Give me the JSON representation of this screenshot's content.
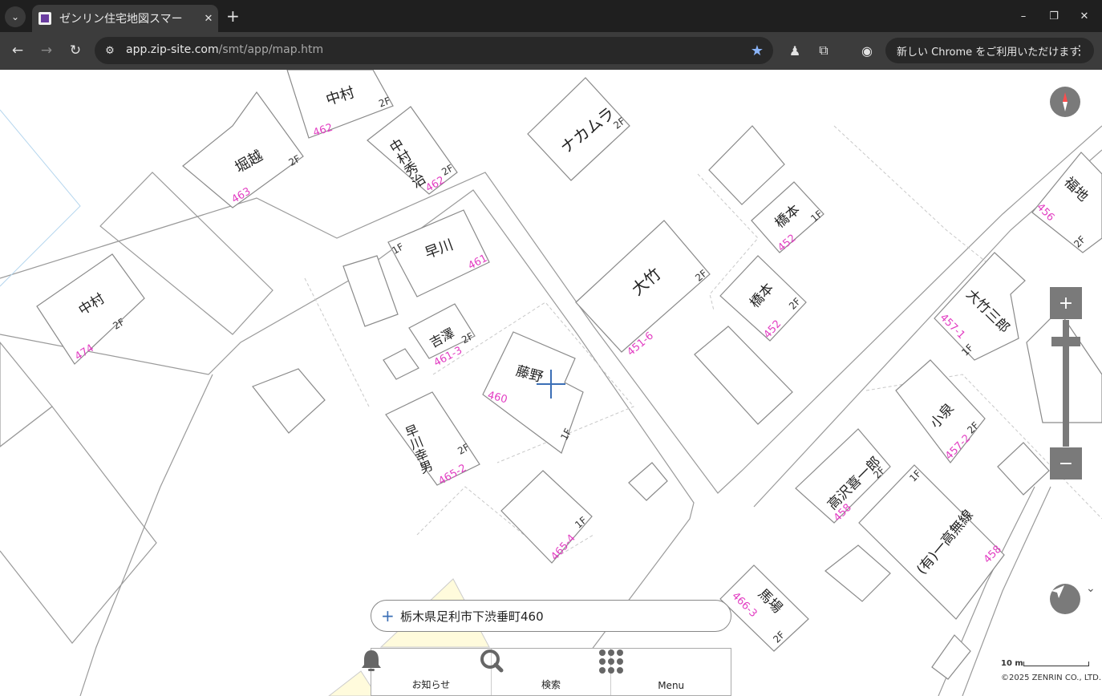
{
  "browser": {
    "tab_title": "ゼンリン住宅地図スマー",
    "url_host": "app.zip-site.com",
    "url_path": "/smt/app/map.htm",
    "update_label": "新しい Chrome をご利用いただけます"
  },
  "map": {
    "labels": {
      "nakamura_top": "中村",
      "horikoshi": "堀越",
      "nakamura_hideji": "中村秀治",
      "nakamura_kata": "ナカムラ",
      "hayakawa": "早川",
      "yoshizawa": "吉澤",
      "fujino": "藤野",
      "hayakawa_yukio": "早川幸男",
      "otake": "大竹",
      "hashimoto_1": "橋本",
      "hashimoto_2": "橋本",
      "fukuchi": "福地",
      "otake_saburo": "大竹三郎",
      "koizumi": "小泉",
      "takazawa": "高沢喜一郎",
      "ichitaka": "(有)一高無線",
      "baba": "馬場",
      "nakamura_left": "中村"
    },
    "numbers": {
      "n462a": "462",
      "n463": "463",
      "n462b": "462",
      "n461": "461",
      "n461_3": "461-3",
      "n460": "460",
      "n465_2": "465-2",
      "n465_4": "465-4",
      "n451_6": "451-6",
      "n452a": "452",
      "n452b": "452",
      "n456": "456",
      "n457_1": "457-1",
      "n457_2": "457-2",
      "n458a": "458",
      "n458b": "458",
      "n466_3": "466-3",
      "n474": "474"
    },
    "address": "栃木県足利市下渋垂町460",
    "scale_label": "10 m",
    "copyright": "©2025 ZENRIN CO., LTD."
  },
  "menu": {
    "notice": "お知らせ",
    "search": "検索",
    "menu": "Menu"
  },
  "colors": {
    "lot_number": "#e23dc2",
    "control_gray": "#7a7a7a",
    "compass_red": "#ff4d4d"
  }
}
